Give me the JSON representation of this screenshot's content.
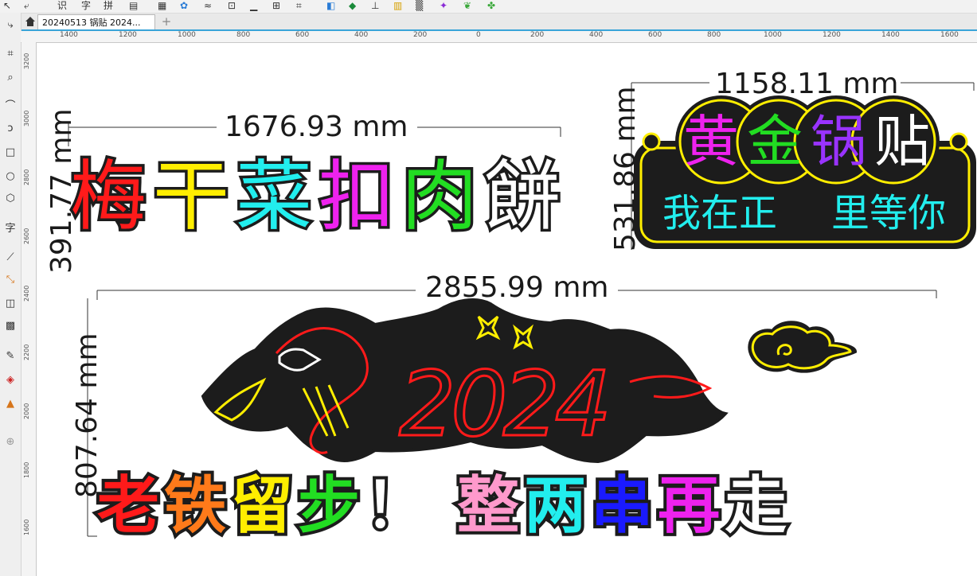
{
  "toolbar": {
    "text_tool_1": "识",
    "text_tool_2": "字",
    "text_tool_3": "拼"
  },
  "document_tab": {
    "title": "20240513 锅贴 2024..."
  },
  "ruler_h": {
    "labels": [
      "1400",
      "1200",
      "1000",
      "800",
      "600",
      "400",
      "200",
      "0",
      "200",
      "400",
      "600",
      "800",
      "1000",
      "1200",
      "1400",
      "1600"
    ]
  },
  "ruler_v": {
    "labels": [
      "3200",
      "3000",
      "2800",
      "2600",
      "2400",
      "2200",
      "2000",
      "1800",
      "1600"
    ]
  },
  "design1": {
    "dimension_width": "1676.93 mm",
    "dimension_height": "391.77 mm",
    "chars": [
      "梅",
      "干",
      "菜",
      "扣",
      "肉",
      "餅"
    ],
    "colors": [
      "#ff1a1a",
      "#ffee00",
      "#22eeee",
      "#ee22ee",
      "#22dd22",
      "#ffffff"
    ]
  },
  "design2": {
    "dimension_width": "1158.11 mm",
    "dimension_height": "531.86 mm",
    "title_chars": [
      "黄",
      "金",
      "锅",
      "贴"
    ],
    "title_colors": [
      "#ee22ee",
      "#22dd22",
      "#9933ff",
      "#ffffff"
    ],
    "line2_left": "我在正",
    "line2_right": "里等你",
    "line2_color": "#22eeee",
    "border_color": "#ffee00"
  },
  "design3": {
    "dimension_width": "2855.99 mm",
    "dimension_height": "807.64 mm",
    "number": "2024",
    "chars": [
      "老",
      "铁",
      "留",
      "步",
      "！",
      "整",
      "两",
      "串",
      "再",
      "走"
    ],
    "colors": [
      "#ff1a1a",
      "#ff7a1a",
      "#ffee00",
      "#22dd22",
      "#ffffff",
      "#ff99cc",
      "#22eeee",
      "#1a1aff",
      "#ee22ee",
      "#ffffff"
    ]
  }
}
